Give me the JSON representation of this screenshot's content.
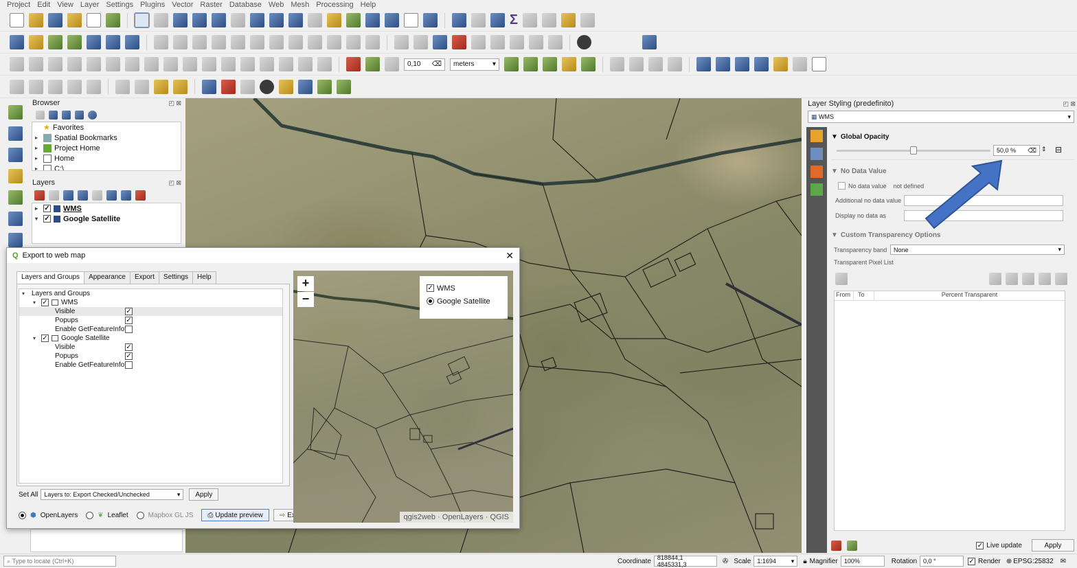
{
  "menu": [
    "Project",
    "Edit",
    "View",
    "Layer",
    "Settings",
    "Plugins",
    "Vector",
    "Raster",
    "Database",
    "Web",
    "Mesh",
    "Processing",
    "Help"
  ],
  "digitizing": {
    "tolerance": "0,10",
    "units": "meters"
  },
  "browser": {
    "title": "Browser",
    "items": [
      "Favorites",
      "Spatial Bookmarks",
      "Project Home",
      "Home",
      "C:\\"
    ]
  },
  "layers": {
    "title": "Layers",
    "items": [
      "WMS",
      "Google Satellite"
    ]
  },
  "dialog": {
    "title": "Export to web map",
    "tabs": [
      "Layers and Groups",
      "Appearance",
      "Export",
      "Settings",
      "Help"
    ],
    "tree": {
      "root": "Layers and Groups",
      "layers": [
        {
          "name": "WMS",
          "props": [
            "Visible",
            "Popups",
            "Enable GetFeatureInfo?"
          ],
          "checked": [
            true,
            true,
            false
          ]
        },
        {
          "name": "Google Satellite",
          "props": [
            "Visible",
            "Popups",
            "Enable GetFeatureInfo?"
          ],
          "checked": [
            true,
            true,
            false
          ]
        }
      ]
    },
    "set_all_label": "Set All",
    "set_all_value": "Layers to: Export Checked/Unchecked",
    "apply_label": "Apply",
    "formats": [
      "OpenLayers",
      "Leaflet",
      "Mapbox GL JS"
    ],
    "update_preview_label": "Update preview",
    "export_label": "Export",
    "preview": {
      "zoom_in": "+",
      "zoom_out": "−",
      "switcher": [
        "WMS",
        "Google Satellite"
      ],
      "attribution": "qgis2web · OpenLayers · QGIS"
    }
  },
  "styling": {
    "title": "Layer Styling (predefinito)",
    "layer": "WMS",
    "global_opacity_label": "Global Opacity",
    "opacity_value": "50,0 %",
    "opacity_fraction": 0.5,
    "no_data_label": "No Data Value",
    "no_data_value_label": "No data value",
    "no_data_value_state": "not defined",
    "additional_no_data_label": "Additional no data value",
    "display_no_data_label": "Display no data as",
    "custom_transparency_label": "Custom Transparency Options",
    "transparency_band_label": "Transparency band",
    "transparency_band_value": "None",
    "pixel_list_label": "Transparent Pixel List",
    "table_headers": [
      "From",
      "To",
      "Percent Transparent"
    ],
    "live_update_label": "Live update",
    "apply_label": "Apply"
  },
  "status": {
    "locate_placeholder": "Type to locate (Ctrl+K)",
    "coordinate_label": "Coordinate",
    "coordinate_value": "818844,1 4845331,3",
    "scale_label": "Scale",
    "scale_value": "1:1694",
    "magnifier_label": "Magnifier",
    "magnifier_value": "100%",
    "rotation_label": "Rotation",
    "rotation_value": "0,0 °",
    "render_label": "Render",
    "crs": "EPSG:25832"
  },
  "colors": {
    "accent": "#2f5597",
    "arrow": "#4472c4"
  }
}
